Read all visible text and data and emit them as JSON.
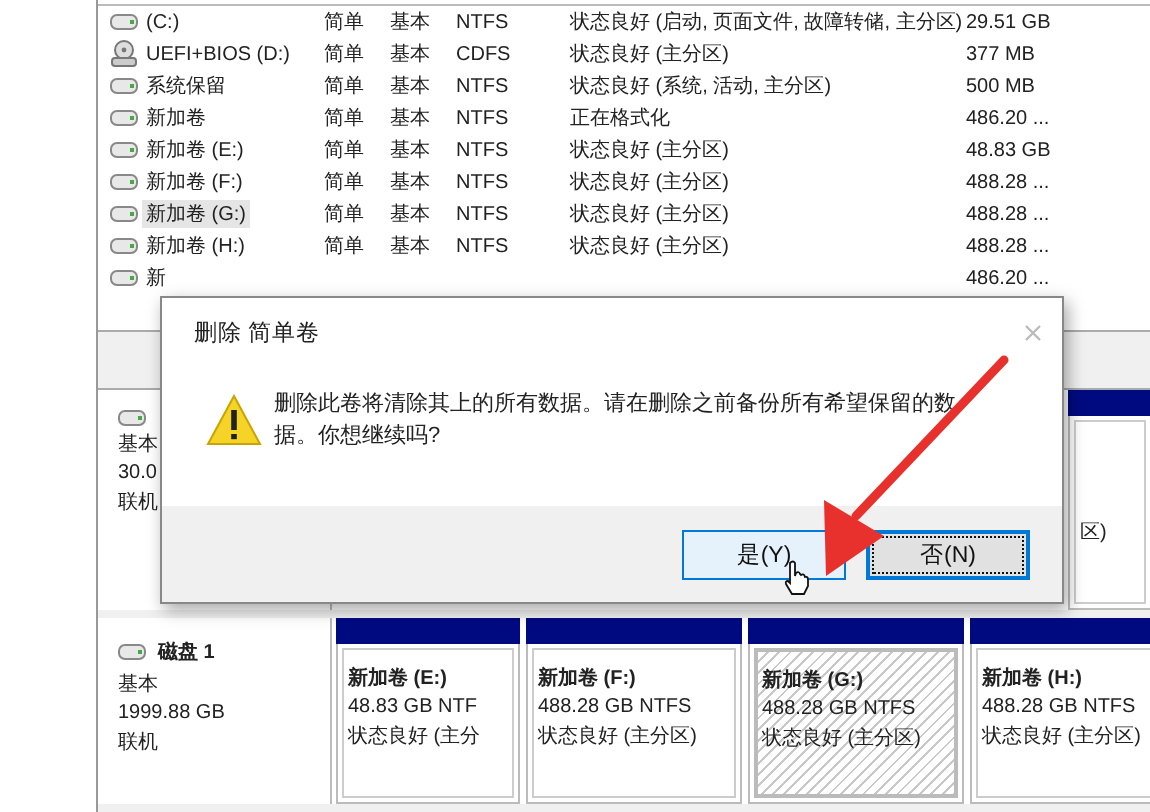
{
  "volumes": [
    {
      "kind": "disk",
      "name": "(C:)",
      "layout": "简单",
      "type": "基本",
      "fs": "NTFS",
      "status": "状态良好 (启动, 页面文件, 故障转储, 主分区)",
      "capacity": "29.51 GB",
      "selected": false
    },
    {
      "kind": "optical",
      "name": "UEFI+BIOS (D:)",
      "layout": "简单",
      "type": "基本",
      "fs": "CDFS",
      "status": "状态良好 (主分区)",
      "capacity": "377 MB",
      "selected": false
    },
    {
      "kind": "disk",
      "name": "系统保留",
      "layout": "简单",
      "type": "基本",
      "fs": "NTFS",
      "status": "状态良好 (系统, 活动, 主分区)",
      "capacity": "500 MB",
      "selected": false
    },
    {
      "kind": "disk",
      "name": "新加卷",
      "layout": "简单",
      "type": "基本",
      "fs": "NTFS",
      "status": "正在格式化",
      "capacity": "486.20 ...",
      "selected": false
    },
    {
      "kind": "disk",
      "name": "新加卷 (E:)",
      "layout": "简单",
      "type": "基本",
      "fs": "NTFS",
      "status": "状态良好 (主分区)",
      "capacity": "48.83 GB",
      "selected": false
    },
    {
      "kind": "disk",
      "name": "新加卷 (F:)",
      "layout": "简单",
      "type": "基本",
      "fs": "NTFS",
      "status": "状态良好 (主分区)",
      "capacity": "488.28 ...",
      "selected": false
    },
    {
      "kind": "disk",
      "name": "新加卷 (G:)",
      "layout": "简单",
      "type": "基本",
      "fs": "NTFS",
      "status": "状态良好 (主分区)",
      "capacity": "488.28 ...",
      "selected": true
    },
    {
      "kind": "disk",
      "name": "新加卷 (H:)",
      "layout": "简单",
      "type": "基本",
      "fs": "NTFS",
      "status": "状态良好 (主分区)",
      "capacity": "488.28 ...",
      "selected": false
    },
    {
      "kind": "disk",
      "name": "新",
      "capacity": "486.20 ...",
      "selected": false
    }
  ],
  "disks": [
    {
      "lines": [
        "基本",
        "30.0",
        "联机"
      ],
      "partitions": [
        {
          "status": "区)",
          "selected": false
        }
      ]
    },
    {
      "name": "磁盘 1",
      "lines": [
        "基本",
        "1999.88 GB",
        "联机"
      ],
      "partitions": [
        {
          "name": "新加卷  (E:)",
          "size": "48.83 GB NTF",
          "status": "状态良好 (主分",
          "selected": false
        },
        {
          "name": "新加卷  (F:)",
          "size": "488.28 GB NTFS",
          "status": "状态良好 (主分区)",
          "selected": false
        },
        {
          "name": "新加卷  (G:)",
          "size": "488.28 GB NTFS",
          "status": "状态良好 (主分区)",
          "selected": true
        },
        {
          "name": "新加卷  (H:)",
          "size": "488.28 GB NTFS",
          "status": "状态良好 (主分区)",
          "selected": false
        }
      ]
    }
  ],
  "dialog": {
    "title": "删除 简单卷",
    "message": "删除此卷将清除其上的所有数据。请在删除之前备份所有希望保留的数据。你想继续吗?",
    "buttons": [
      {
        "label": "是(Y)",
        "hover": true,
        "focus": false
      },
      {
        "label": "否(N)",
        "hover": false,
        "focus": true
      }
    ]
  }
}
